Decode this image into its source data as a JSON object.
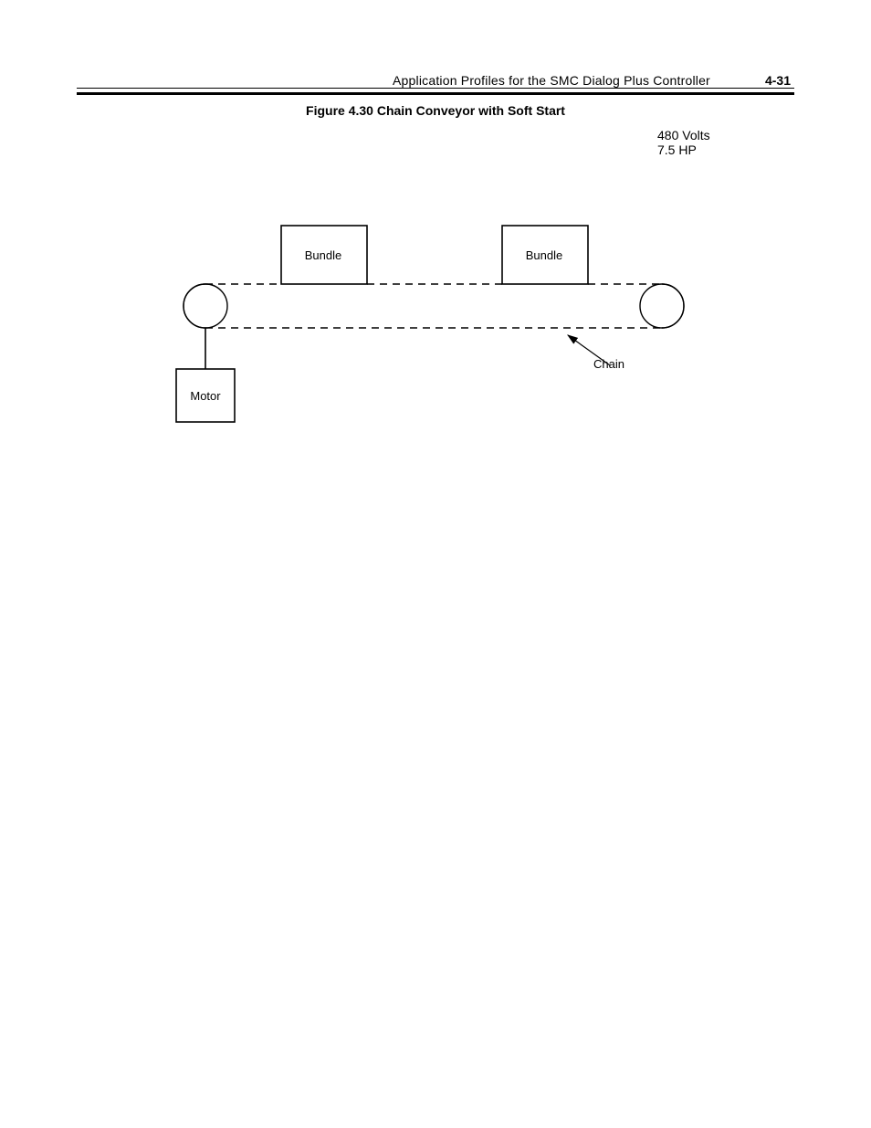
{
  "header": {
    "title": "Application Profiles for the SMC Dialog Plus Controller",
    "page_number": "4-31"
  },
  "figure": {
    "caption": "Figure 4.30 Chain Conveyor with Soft Start",
    "specs": {
      "volts": "480 Volts",
      "hp": "7.5 HP"
    },
    "labels": {
      "bundle_left": "Bundle",
      "bundle_right": "Bundle",
      "motor": "Motor",
      "chain": "Chain"
    }
  }
}
